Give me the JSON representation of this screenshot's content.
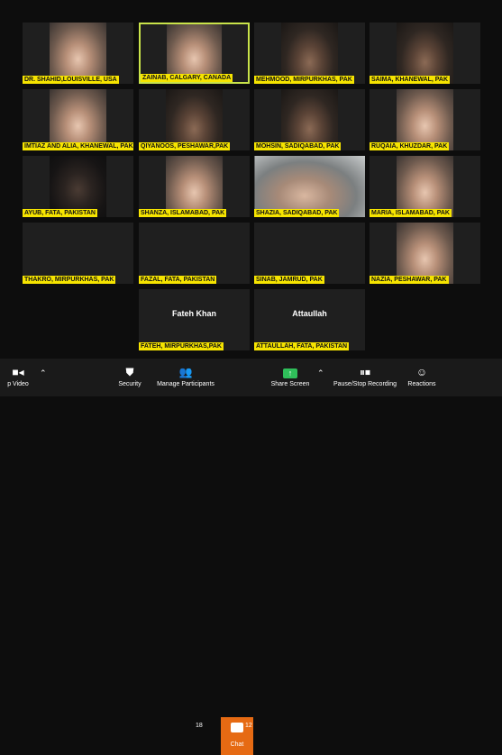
{
  "tiles": [
    {
      "name": "DR. SHAHID,LOUISVILLE, USA"
    },
    {
      "name": "ZAINAB, CALGARY, CANADA"
    },
    {
      "name": "MEHMOOD, MIRPURKHAS, PAK"
    },
    {
      "name": "SAIMA, KHANEWAL, PAK"
    },
    {
      "name": "IMTIAZ AND ALIA, KHANEWAL, PAK"
    },
    {
      "name": "QIYANOOS, PESHAWAR,PAK"
    },
    {
      "name": "MOHSIN, SADIQABAD, PAK"
    },
    {
      "name": "RUQAIA, KHUZDAR, PAK"
    },
    {
      "name": "AYUB, FATA, PAKISTAN"
    },
    {
      "name": "SHANZA, ISLAMABAD, PAK"
    },
    {
      "name": "SHAZIA, SADIQABAD, PAK"
    },
    {
      "name": "MARIA, ISLAMABAD, PAK"
    },
    {
      "name": "THAKRO, MIRPURKHAS, PAK"
    },
    {
      "name": "FAZAL, FATA, PAKISTAN"
    },
    {
      "name": "SINAB, JAMRUD, PAK"
    },
    {
      "name": "NAZIA, PESHAWAR, PAK"
    },
    {
      "name": "FATEH, MIRPURKHAS,PAK",
      "display_name": "Fateh Khan"
    },
    {
      "name": "ATTAULLAH, FATA, PAKISTAN",
      "display_name": "Attaullah"
    }
  ],
  "toolbar": {
    "video_label": "p Video",
    "security_label": "Security",
    "participants_label": "Manage Participants",
    "participants_count": "18",
    "chat_label": "Chat",
    "chat_count": "12",
    "share_label": "Share Screen",
    "record_label": "Pause/Stop Recording",
    "reactions_label": "Reactions"
  }
}
